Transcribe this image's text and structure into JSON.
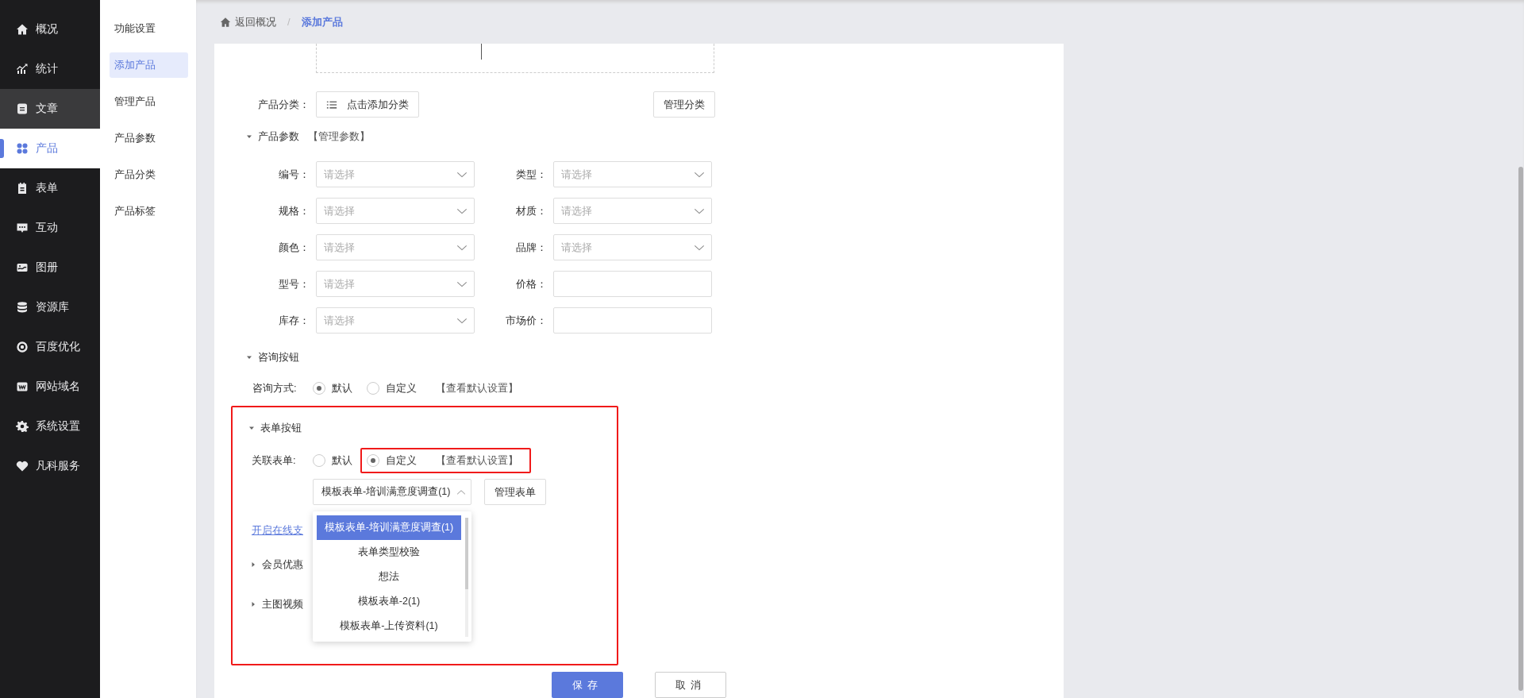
{
  "nav": [
    {
      "label": "概况",
      "selected": false,
      "hovered": false
    },
    {
      "label": "统计",
      "selected": false,
      "hovered": false
    },
    {
      "label": "文章",
      "selected": false,
      "hovered": true
    },
    {
      "label": "产品",
      "selected": true,
      "hovered": false
    },
    {
      "label": "表单",
      "selected": false,
      "hovered": false
    },
    {
      "label": "互动",
      "selected": false,
      "hovered": false
    },
    {
      "label": "图册",
      "selected": false,
      "hovered": false
    },
    {
      "label": "资源库",
      "selected": false,
      "hovered": false
    },
    {
      "label": "百度优化",
      "selected": false,
      "hovered": false
    },
    {
      "label": "网站域名",
      "selected": false,
      "hovered": false
    },
    {
      "label": "系统设置",
      "selected": false,
      "hovered": false
    },
    {
      "label": "凡科服务",
      "selected": false,
      "hovered": false
    }
  ],
  "sub_nav": [
    {
      "label": "功能设置",
      "selected": false
    },
    {
      "label": "添加产品",
      "selected": true
    },
    {
      "label": "管理产品",
      "selected": false
    },
    {
      "label": "产品参数",
      "selected": false
    },
    {
      "label": "产品分类",
      "selected": false
    },
    {
      "label": "产品标签",
      "selected": false
    }
  ],
  "breadcrumb": {
    "back": "返回概况",
    "separator": "/",
    "current": "添加产品"
  },
  "category": {
    "label": "产品分类：",
    "button": "点击添加分类",
    "manage": "管理分类"
  },
  "params": {
    "title": "产品参数",
    "expanded": true,
    "link": "【管理参数】",
    "fields": [
      {
        "label": "编号：",
        "kind": "select",
        "placeholder": "请选择"
      },
      {
        "label": "类型：",
        "kind": "select",
        "placeholder": "请选择"
      },
      {
        "label": "规格：",
        "kind": "select",
        "placeholder": "请选择"
      },
      {
        "label": "材质：",
        "kind": "select",
        "placeholder": "请选择"
      },
      {
        "label": "颜色：",
        "kind": "select",
        "placeholder": "请选择"
      },
      {
        "label": "品牌：",
        "kind": "select",
        "placeholder": "请选择"
      },
      {
        "label": "型号：",
        "kind": "select",
        "placeholder": "请选择"
      },
      {
        "label": "价格：",
        "kind": "input"
      },
      {
        "label": "库存：",
        "kind": "select",
        "placeholder": "请选择"
      },
      {
        "label": "市场价：",
        "kind": "input"
      }
    ]
  },
  "consult": {
    "title": "咨询按钮",
    "expanded": true,
    "label": "咨询方式:",
    "options": [
      {
        "label": "默认",
        "selected": true
      },
      {
        "label": "自定义",
        "selected": false
      }
    ],
    "link": "【查看默认设置】"
  },
  "form_button": {
    "title": "表单按钮",
    "expanded": true,
    "label": "关联表单:",
    "options": [
      {
        "label": "默认",
        "selected": false
      },
      {
        "label": "自定义",
        "selected": true
      }
    ],
    "link": "【查看默认设置】",
    "select": {
      "value": "模板表单-培训满意度调查(1)",
      "expanded": true
    },
    "manage": "管理表单",
    "menu": [
      {
        "label": "模板表单-培训满意度调查(1)",
        "selected": true
      },
      {
        "label": "表单类型校验",
        "selected": false
      },
      {
        "label": "想法",
        "selected": false
      },
      {
        "label": "模板表单-2(1)",
        "selected": false
      },
      {
        "label": "模板表单-上传资料(1)",
        "selected": false
      }
    ]
  },
  "pay_link": "开启在线支",
  "sections": [
    {
      "title": "会员优惠",
      "expanded": false
    },
    {
      "title": "主图视频",
      "expanded": false
    }
  ],
  "actions": {
    "save": "保存",
    "cancel": "取消"
  }
}
